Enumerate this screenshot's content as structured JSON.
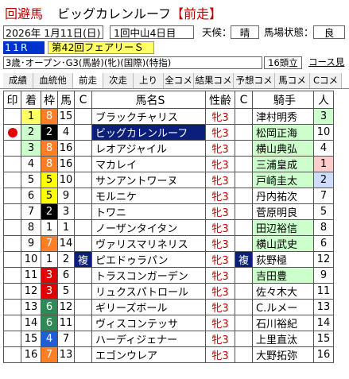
{
  "header": {
    "section_label": "回避馬",
    "horse_name": "ビッグカレンルーフ",
    "tag": "【前走】"
  },
  "info": {
    "date": "2026年 1月11日(日)",
    "venue": "1回中山4日目",
    "weather_label": "天候：",
    "weather": "晴",
    "track_label": "馬場状態：",
    "track": "良"
  },
  "race": {
    "number": "11R",
    "name": "第42回フェアリーＳ",
    "conditions": "3歳･オープン･G3(馬齢)(牝)(国際)(特指)",
    "field_size": "16頭立",
    "course_link": "コース見"
  },
  "tabs": [
    "成績",
    "血統他",
    "前走",
    "次走",
    "上り",
    "全コメ",
    "結果コメ",
    "予想コメ",
    "馬コメ",
    "Cコメ"
  ],
  "table": {
    "headers": [
      "印",
      "着",
      "枠",
      "馬",
      "C",
      "馬名S",
      "性齢",
      "C",
      "騎手",
      "人"
    ],
    "rows": [
      {
        "mark": "",
        "order": "1",
        "frame": "8",
        "num": "15",
        "c": "",
        "name": "ブラックチャリス",
        "sexage": "牝3",
        "c2": "",
        "jockey": "津村明秀",
        "pop": "3",
        "frame_bg": "#ff7f27",
        "ord_bg": "#ffff66",
        "frame_fg": "#fff"
      },
      {
        "mark": "dot",
        "order": "2",
        "frame": "2",
        "num": "4",
        "c": "",
        "name": "ビッグカレンルーフ",
        "sexage": "牝3",
        "c2": "",
        "jockey": "松岡正海",
        "pop": "10",
        "frame_bg": "#000000",
        "ord_bg": "#ccffcc",
        "frame_fg": "#fff"
      },
      {
        "mark": "",
        "order": "3",
        "frame": "8",
        "num": "16",
        "c": "",
        "name": "レオアジャイル",
        "sexage": "牝3",
        "c2": "",
        "jockey": "横山典弘",
        "pop": "4",
        "frame_bg": "#ff7f27",
        "ord_bg": "#ccffcc",
        "frame_fg": "#fff"
      },
      {
        "mark": "",
        "order": "4",
        "frame": "8",
        "num": "16",
        "c": "",
        "name": "マカレイ",
        "sexage": "牝3",
        "c2": "",
        "jockey": "三浦皇成",
        "pop": "1",
        "frame_bg": "#ff7f27",
        "ord_bg": "",
        "frame_fg": "#fff"
      },
      {
        "mark": "",
        "order": "5",
        "frame": "5",
        "num": "10",
        "c": "",
        "name": "サンアントワーヌ",
        "sexage": "牝3",
        "c2": "",
        "jockey": "戸崎圭太",
        "pop": "2",
        "frame_bg": "#ffff00",
        "ord_bg": "",
        "frame_fg": "#000"
      },
      {
        "mark": "",
        "order": "6",
        "frame": "5",
        "num": "9",
        "c": "",
        "name": "モルニケ",
        "sexage": "牝3",
        "c2": "",
        "jockey": "丹内祐次",
        "pop": "7",
        "frame_bg": "#ffff00",
        "ord_bg": "",
        "frame_fg": "#000"
      },
      {
        "mark": "",
        "order": "7",
        "frame": "2",
        "num": "3",
        "c": "",
        "name": "トワニ",
        "sexage": "牝3",
        "c2": "",
        "jockey": "菅原明良",
        "pop": "5",
        "frame_bg": "#000000",
        "ord_bg": "",
        "frame_fg": "#fff"
      },
      {
        "mark": "",
        "order": "8",
        "frame": "1",
        "num": "1",
        "c": "",
        "name": "ノーザンタイタン",
        "sexage": "牝3",
        "c2": "",
        "jockey": "田辺裕信",
        "pop": "8",
        "frame_bg": "#ffffff",
        "ord_bg": "",
        "frame_fg": "#000"
      },
      {
        "mark": "",
        "order": "9",
        "frame": "7",
        "num": "14",
        "c": "",
        "name": "ヴァリスマリネリス",
        "sexage": "牝3",
        "c2": "",
        "jockey": "横山武史",
        "pop": "6",
        "frame_bg": "#ff7f27",
        "ord_bg": "",
        "frame_fg": "#fff"
      },
      {
        "mark": "",
        "order": "10",
        "frame": "1",
        "num": "2",
        "c": "複",
        "name": "ピエドゥラパン",
        "sexage": "牝3",
        "c2": "複",
        "jockey": "荻野極",
        "pop": "12",
        "frame_bg": "#ffffff",
        "ord_bg": "",
        "frame_fg": "#000"
      },
      {
        "mark": "",
        "order": "11",
        "frame": "3",
        "num": "6",
        "c": "",
        "name": "トラスコンガーデン",
        "sexage": "牝3",
        "c2": "",
        "jockey": "吉田豊",
        "pop": "9",
        "frame_bg": "#e00000",
        "ord_bg": "",
        "frame_fg": "#fff"
      },
      {
        "mark": "",
        "order": "12",
        "frame": "3",
        "num": "5",
        "c": "",
        "name": "リュクスパトロール",
        "sexage": "牝3",
        "c2": "",
        "jockey": "佐々木大",
        "pop": "11",
        "frame_bg": "#e00000",
        "ord_bg": "",
        "frame_fg": "#fff"
      },
      {
        "mark": "",
        "order": "13",
        "frame": "6",
        "num": "12",
        "c": "",
        "name": "ギリーズボール",
        "sexage": "牝3",
        "c2": "",
        "jockey": "C.ルメー",
        "pop": "13",
        "frame_bg": "#2e8b57",
        "ord_bg": "",
        "frame_fg": "#fff"
      },
      {
        "mark": "",
        "order": "14",
        "frame": "6",
        "num": "11",
        "c": "",
        "name": "ヴィスコンテッサ",
        "sexage": "牝3",
        "c2": "",
        "jockey": "石川裕紀",
        "pop": "14",
        "frame_bg": "#2e8b57",
        "ord_bg": "",
        "frame_fg": "#fff"
      },
      {
        "mark": "",
        "order": "15",
        "frame": "4",
        "num": "7",
        "c": "",
        "name": "ハーディジェナー",
        "sexage": "牝3",
        "c2": "",
        "jockey": "上里直汰",
        "pop": "15",
        "frame_bg": "#1e5fd8",
        "ord_bg": "",
        "frame_fg": "#fff"
      },
      {
        "mark": "",
        "order": "16",
        "frame": "7",
        "num": "13",
        "c": "",
        "name": "エゴンウレア",
        "sexage": "牝3",
        "c2": "",
        "jockey": "大野拓弥",
        "pop": "16",
        "frame_bg": "#ff7f27",
        "ord_bg": "",
        "frame_fg": "#fff"
      }
    ]
  }
}
